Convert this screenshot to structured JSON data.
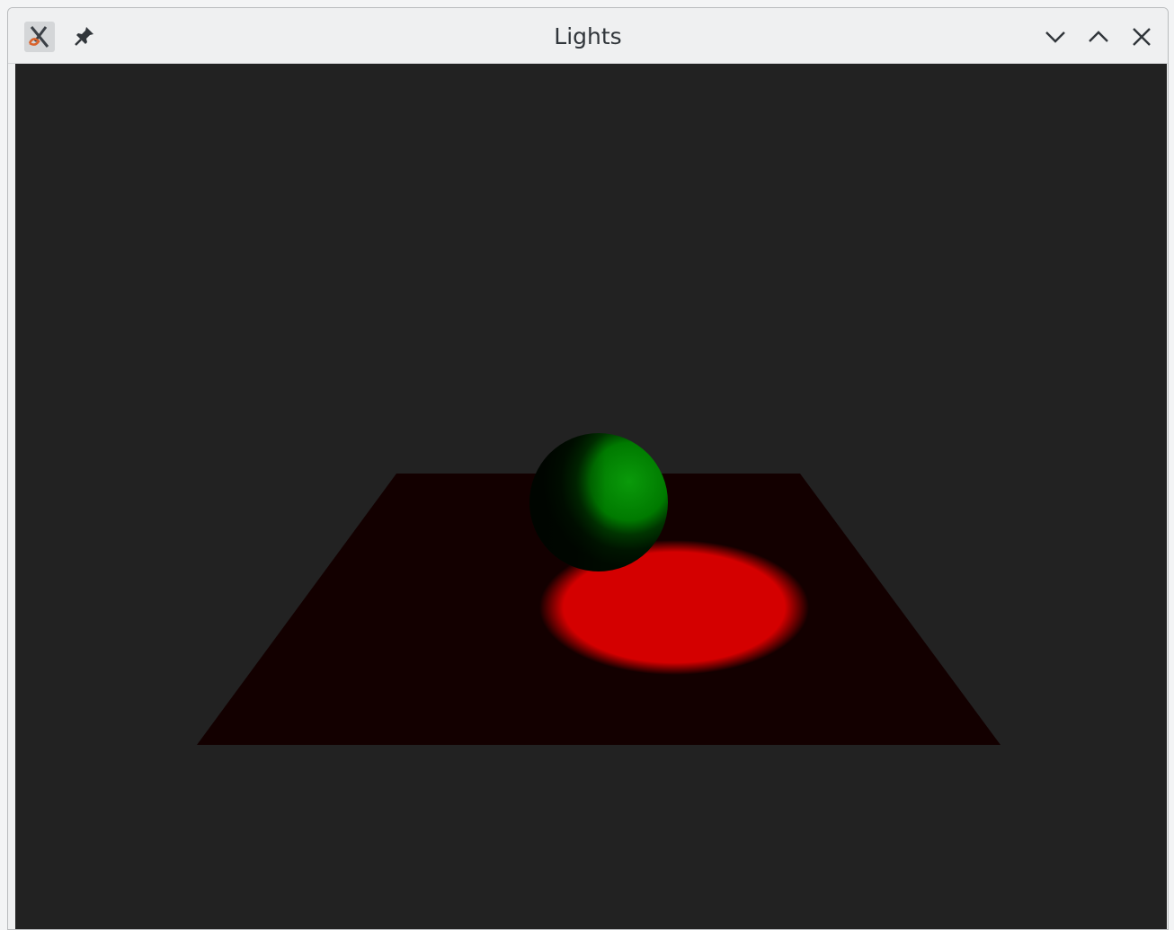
{
  "window": {
    "title": "Lights"
  },
  "titlebar": {
    "app_icon": "x-tool-icon",
    "pin_icon": "pin-icon",
    "minimize_icon": "chevron-down-icon",
    "maximize_icon": "chevron-up-icon",
    "close_icon": "close-icon"
  },
  "scene": {
    "background_color": "#222222",
    "plane_color": "#130000",
    "sphere_color": "#008a00",
    "spotlight_color": "#d40000"
  }
}
